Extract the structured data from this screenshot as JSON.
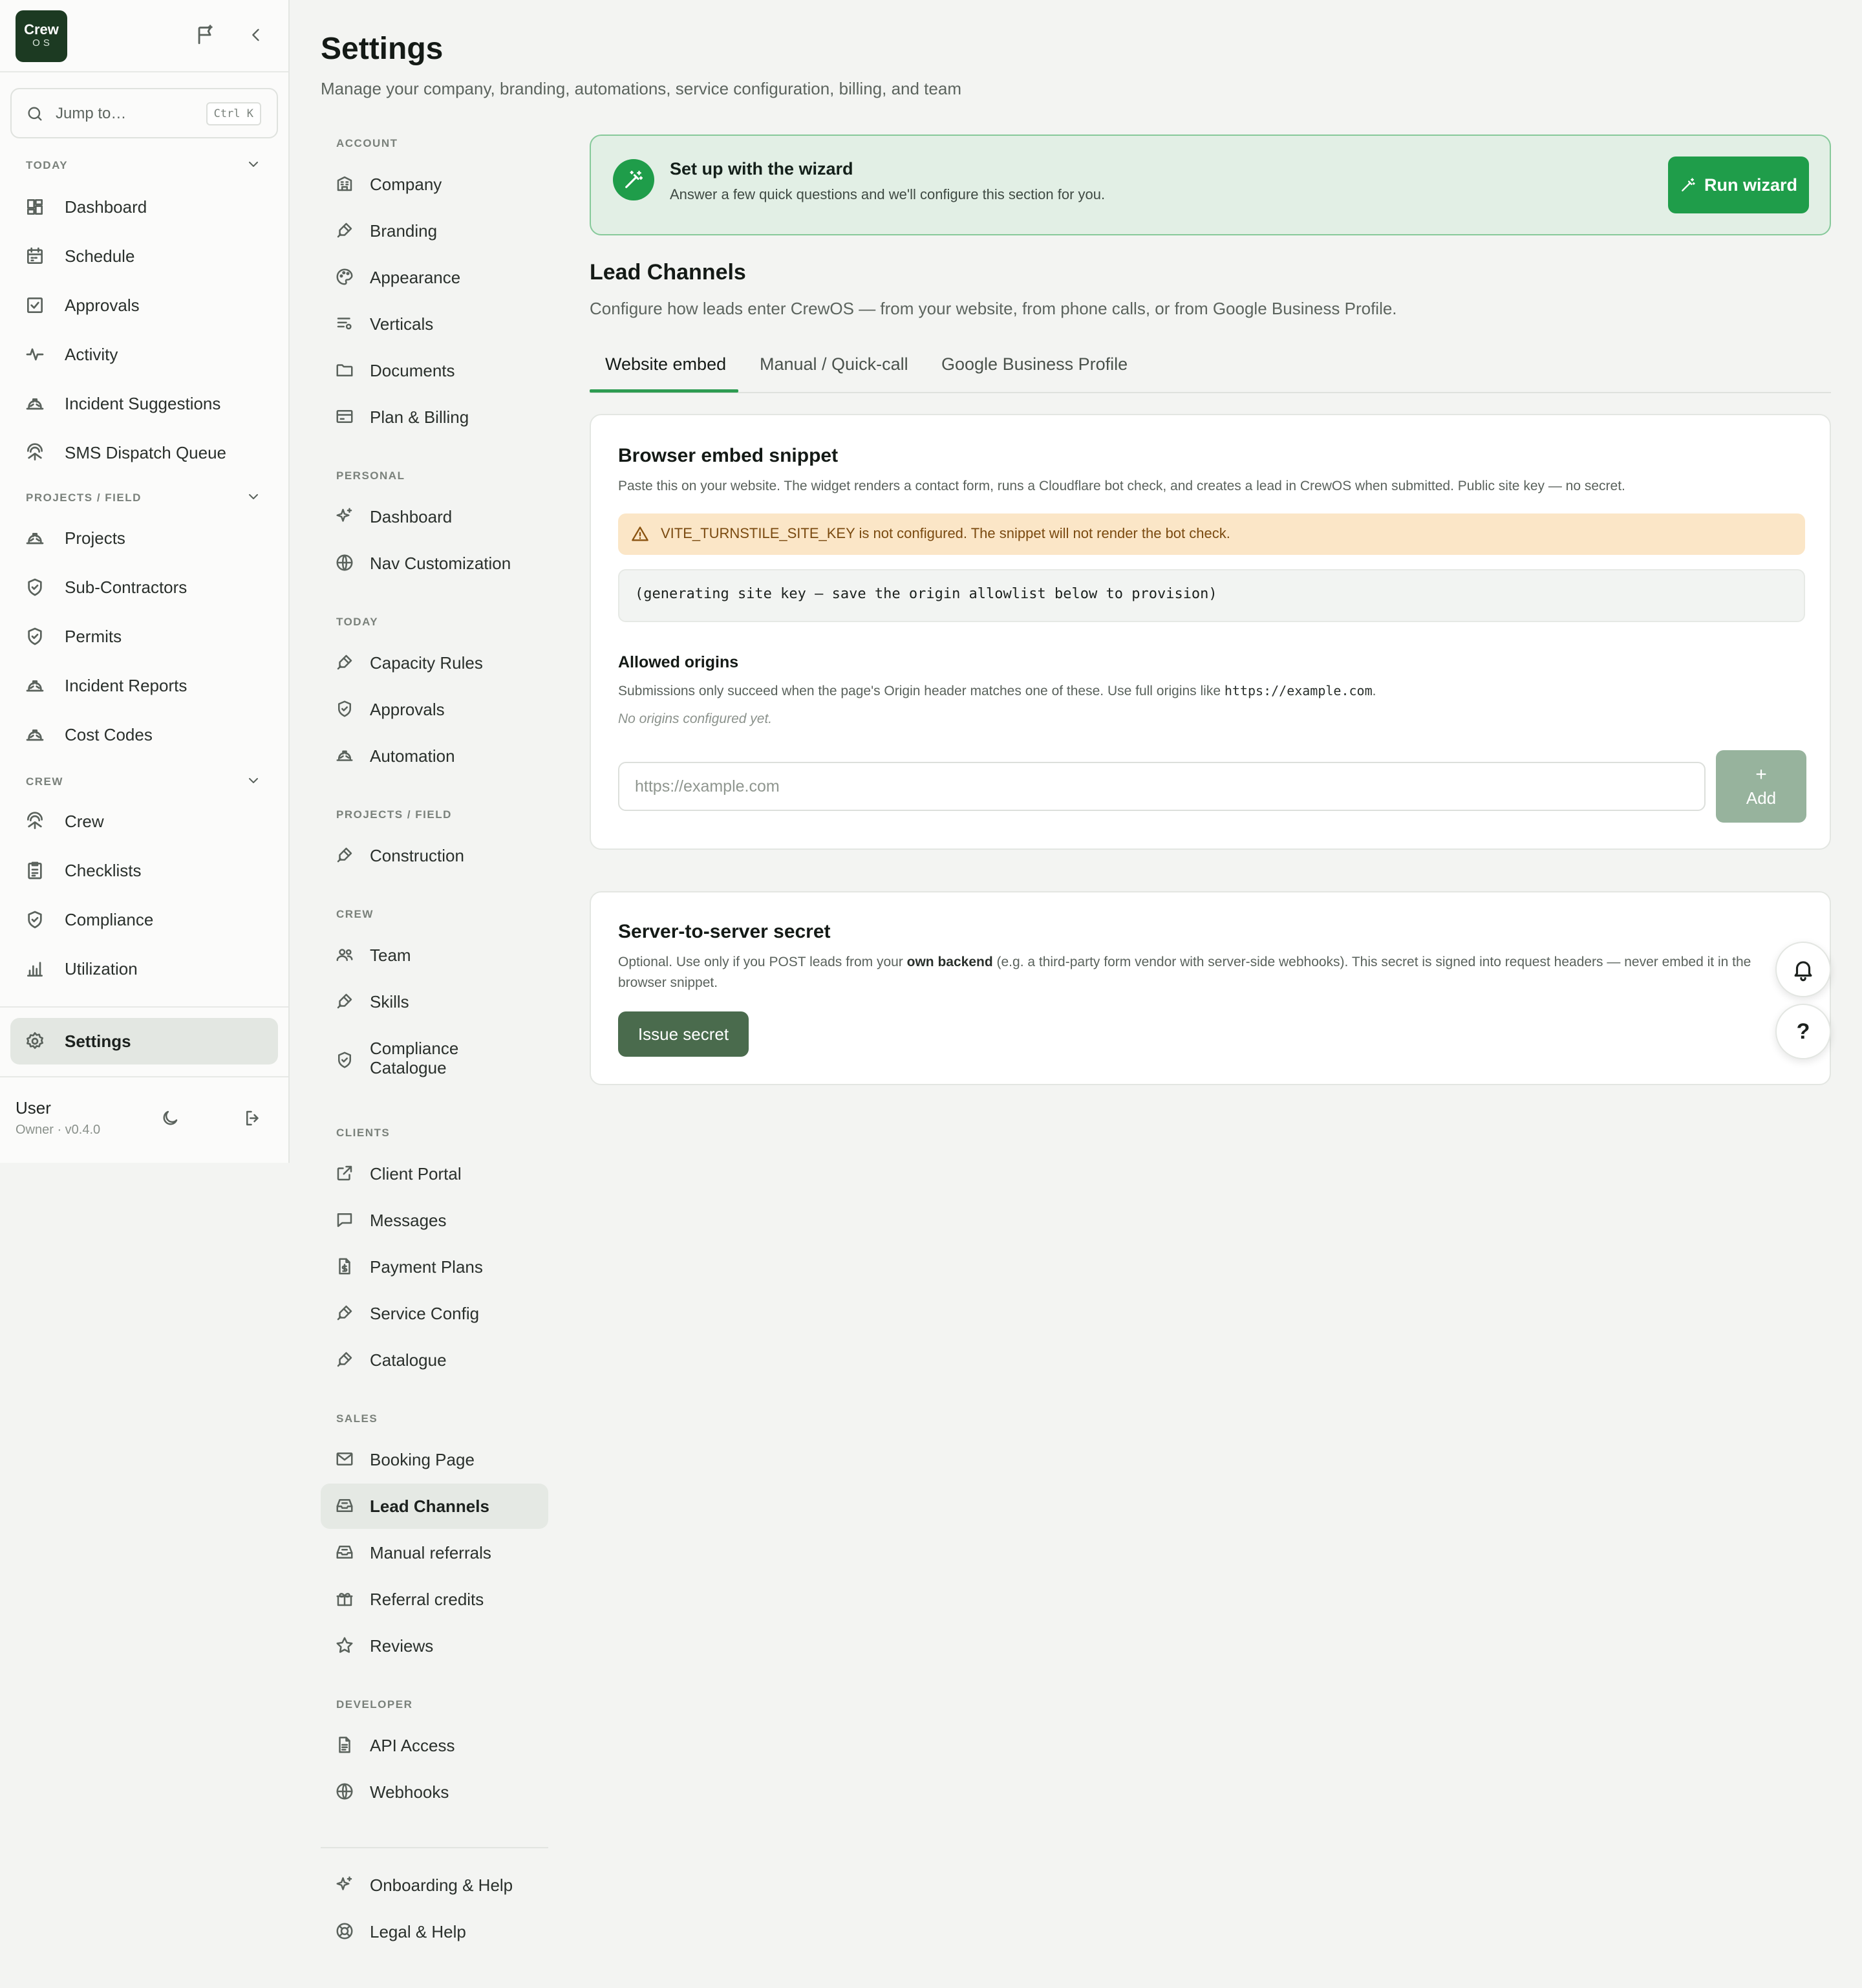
{
  "logo": {
    "line1": "Crew",
    "line2": "OS"
  },
  "search": {
    "placeholder": "Jump to…",
    "shortcut": "Ctrl K"
  },
  "sidebar": {
    "sections": [
      {
        "label": "TODAY",
        "items": [
          {
            "label": "Dashboard",
            "icon": "dashboard-icon"
          },
          {
            "label": "Schedule",
            "icon": "calendar-icon"
          },
          {
            "label": "Approvals",
            "icon": "checkbox-icon"
          },
          {
            "label": "Activity",
            "icon": "activity-icon"
          },
          {
            "label": "Incident Suggestions",
            "icon": "hard-hat-icon"
          },
          {
            "label": "SMS Dispatch Queue",
            "icon": "crew-icon"
          }
        ]
      },
      {
        "label": "PROJECTS / FIELD",
        "items": [
          {
            "label": "Projects",
            "icon": "hard-hat-icon"
          },
          {
            "label": "Sub-Contractors",
            "icon": "shield-check-icon"
          },
          {
            "label": "Permits",
            "icon": "shield-check-icon"
          },
          {
            "label": "Incident Reports",
            "icon": "hard-hat-icon"
          },
          {
            "label": "Cost Codes",
            "icon": "hard-hat-icon"
          }
        ]
      },
      {
        "label": "CREW",
        "items": [
          {
            "label": "Crew",
            "icon": "crew-icon"
          },
          {
            "label": "Checklists",
            "icon": "clipboard-icon"
          },
          {
            "label": "Compliance",
            "icon": "shield-check-icon"
          },
          {
            "label": "Utilization",
            "icon": "bar-chart-icon"
          }
        ]
      }
    ],
    "settings_label": "Settings",
    "user": {
      "name": "User",
      "role": "Owner · v0.4.0"
    }
  },
  "page": {
    "title": "Settings",
    "subtitle": "Manage your company, branding, automations, service configuration, billing, and team"
  },
  "settings_nav": {
    "sections": [
      {
        "label": "ACCOUNT",
        "items": [
          {
            "label": "Company",
            "icon": "building-icon"
          },
          {
            "label": "Branding",
            "icon": "brush-icon"
          },
          {
            "label": "Appearance",
            "icon": "palette-icon"
          },
          {
            "label": "Verticals",
            "icon": "list-settings-icon"
          },
          {
            "label": "Documents",
            "icon": "folder-icon"
          },
          {
            "label": "Plan & Billing",
            "icon": "credit-card-icon"
          }
        ]
      },
      {
        "label": "PERSONAL",
        "items": [
          {
            "label": "Dashboard",
            "icon": "sparkles-icon"
          },
          {
            "label": "Nav Customization",
            "icon": "globe-icon"
          }
        ]
      },
      {
        "label": "TODAY",
        "items": [
          {
            "label": "Capacity Rules",
            "icon": "brush-icon"
          },
          {
            "label": "Approvals",
            "icon": "shield-check-icon"
          },
          {
            "label": "Automation",
            "icon": "hard-hat-icon"
          }
        ]
      },
      {
        "label": "PROJECTS / FIELD",
        "items": [
          {
            "label": "Construction",
            "icon": "brush-icon"
          }
        ]
      },
      {
        "label": "CREW",
        "items": [
          {
            "label": "Team",
            "icon": "users-icon"
          },
          {
            "label": "Skills",
            "icon": "brush-icon"
          },
          {
            "label": "Compliance\nCatalogue",
            "icon": "shield-check-icon"
          }
        ]
      },
      {
        "label": "CLIENTS",
        "items": [
          {
            "label": "Client Portal",
            "icon": "external-link-icon"
          },
          {
            "label": "Messages",
            "icon": "message-icon"
          },
          {
            "label": "Payment Plans",
            "icon": "file-dollar-icon"
          },
          {
            "label": "Service Config",
            "icon": "brush-icon"
          },
          {
            "label": "Catalogue",
            "icon": "brush-icon"
          }
        ]
      },
      {
        "label": "SALES",
        "items": [
          {
            "label": "Booking Page",
            "icon": "mail-icon"
          },
          {
            "label": "Lead Channels",
            "icon": "inbox-icon"
          },
          {
            "label": "Manual referrals",
            "icon": "inbox-icon"
          },
          {
            "label": "Referral credits",
            "icon": "gift-icon"
          },
          {
            "label": "Reviews",
            "icon": "star-icon"
          }
        ]
      },
      {
        "label": "DEVELOPER",
        "items": [
          {
            "label": "API Access",
            "icon": "file-text-icon"
          },
          {
            "label": "Webhooks",
            "icon": "globe-icon"
          }
        ]
      }
    ],
    "footer_items": [
      {
        "label": "Onboarding & Help",
        "icon": "sparkles-icon"
      },
      {
        "label": "Legal & Help",
        "icon": "lifebuoy-icon"
      }
    ],
    "active": "Lead Channels"
  },
  "wizard": {
    "title": "Set up with the wizard",
    "description": "Answer a few quick questions and we'll configure this section for you.",
    "button": "Run wizard"
  },
  "lead_channels": {
    "title": "Lead Channels",
    "subtitle": "Configure how leads enter CrewOS — from your website, from phone calls, or from Google Business Profile.",
    "tabs": [
      "Website embed",
      "Manual / Quick-call",
      "Google Business Profile"
    ],
    "active_tab": "Website embed"
  },
  "embed_card": {
    "title": "Browser embed snippet",
    "description": "Paste this on your website. The widget renders a contact form, runs a Cloudflare bot check, and creates a lead in CrewOS when submitted. Public site key — no secret.",
    "warning": "VITE_TURNSTILE_SITE_KEY is not configured. The snippet will not render the bot check.",
    "snippet": "(generating site key — save the origin allowlist below to provision)",
    "origins_title": "Allowed origins",
    "origins_desc_prefix": "Submissions only succeed when the page's Origin header matches one of these. Use full origins like ",
    "origins_desc_code": "https://example.com",
    "origins_desc_suffix": ".",
    "origins_empty": "No origins configured yet.",
    "origin_placeholder": "https://example.com",
    "origin_value": "",
    "add_plus": "+",
    "add_label": "Add"
  },
  "secret_card": {
    "title": "Server-to-server secret",
    "desc_prefix": "Optional. Use only if you POST leads from your ",
    "desc_bold": "own backend",
    "desc_suffix": " (e.g. a third-party form vendor with server-side webhooks). This secret is signed into request headers — never embed it in the browser snippet.",
    "button": "Issue secret"
  },
  "fab": {
    "help": "?"
  },
  "colors": {
    "accent": "#1f9d4a",
    "brand_dark": "#1c3a22",
    "warning_bg": "#fbe6c7",
    "active_bg": "#e3e7e2"
  }
}
